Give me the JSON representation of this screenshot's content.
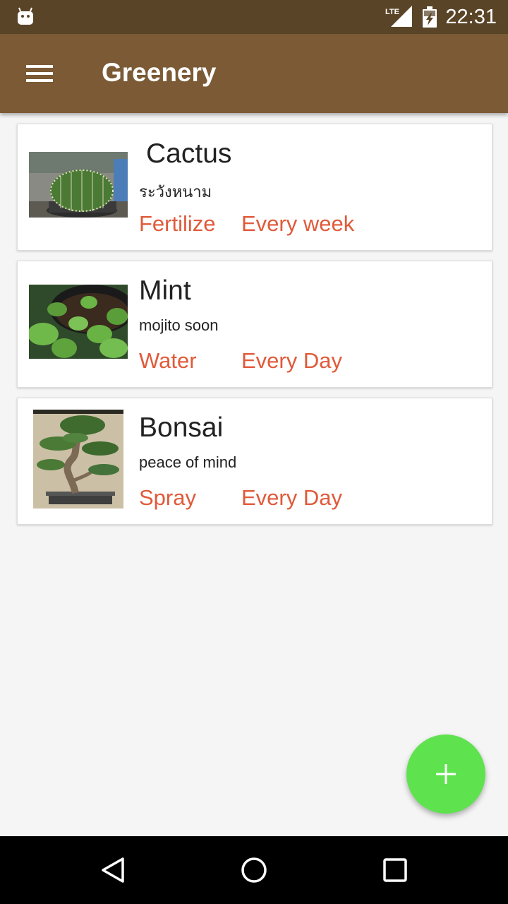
{
  "status_bar": {
    "network_label": "LTE",
    "time": "22:31"
  },
  "app_bar": {
    "title": "Greenery",
    "menu_icon": "hamburger-menu-icon"
  },
  "plants": [
    {
      "name": "Cactus",
      "note": "ระวังหนาม",
      "action": "Fertilize",
      "frequency": "Every week",
      "image": "cactus-photo"
    },
    {
      "name": "Mint",
      "note": "mojito soon",
      "action": "Water",
      "frequency": "Every Day",
      "image": "mint-photo"
    },
    {
      "name": "Bonsai",
      "note": "peace of mind",
      "action": "Spray",
      "frequency": "Every Day",
      "image": "bonsai-photo"
    }
  ],
  "fab": {
    "icon": "plus-icon",
    "color": "#5ee34e"
  },
  "colors": {
    "status_bar": "#5a4427",
    "app_bar": "#7b5a35",
    "accent_text": "#e05a3a",
    "background": "#f5f5f5"
  },
  "nav_bar": {
    "icons": [
      "back-triangle-icon",
      "home-circle-icon",
      "recents-square-icon"
    ]
  }
}
